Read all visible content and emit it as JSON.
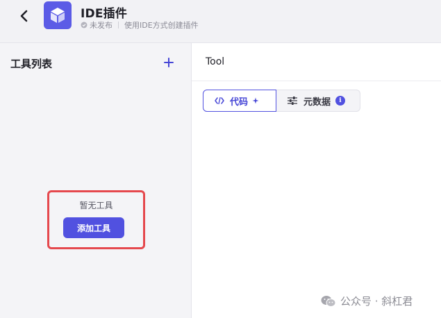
{
  "header": {
    "title": "IDE插件",
    "status": "未发布",
    "description": "使用IDE方式创建插件"
  },
  "sidebar": {
    "title": "工具列表",
    "empty_text": "暂无工具",
    "add_button_label": "添加工具"
  },
  "main": {
    "title": "Tool",
    "tabs": [
      {
        "label": "代码",
        "active": true
      },
      {
        "label": "元数据",
        "active": false
      }
    ],
    "info_badge": "i"
  },
  "watermark": {
    "text": "公众号 · 斜杠君"
  },
  "colors": {
    "accent": "#5151e0",
    "highlight_border": "#e5484d",
    "header_bg": "#f2f2f5",
    "sidebar_bg": "#f4f4f7"
  }
}
